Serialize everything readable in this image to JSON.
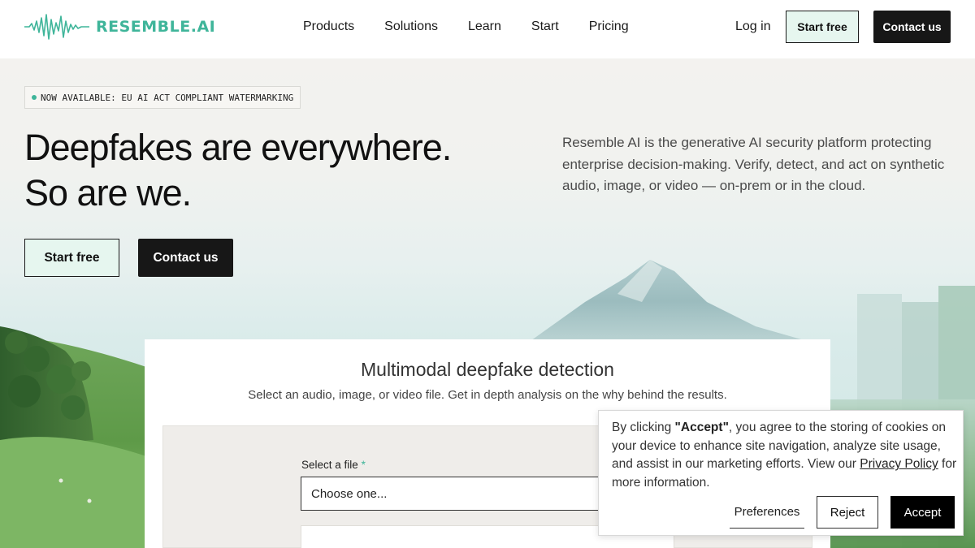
{
  "nav": {
    "logo_text": "RESEMBLE.AI",
    "links": [
      "Products",
      "Solutions",
      "Learn",
      "Start",
      "Pricing"
    ],
    "login": "Log in",
    "start_free": "Start free",
    "contact": "Contact us"
  },
  "hero": {
    "badge": "NOW AVAILABLE: EU AI ACT COMPLIANT WATERMARKING",
    "title_line1": "Deepfakes are everywhere.",
    "title_line2": "So are we.",
    "description": "Resemble AI is the generative AI security platform protecting enterprise decision-making. Verify, detect, and act on synthetic audio, image, or video — on-prem or in the cloud.",
    "start_free": "Start free",
    "contact": "Contact us"
  },
  "detection": {
    "title": "Multimodal deepfake detection",
    "subtitle": "Select an audio, image, or video file. Get in depth analysis on the why behind the results.",
    "file_label": "Select a file",
    "required_mark": "*",
    "file_placeholder": "Choose one..."
  },
  "cookie": {
    "text_before": "By clicking ",
    "accept_quoted": "\"Accept\"",
    "text_middle": ", you agree to the storing of cookies on your device to enhance site navigation, analyze site usage, and assist in our marketing efforts. View our ",
    "privacy_link": "Privacy Policy",
    "text_after": " for more information.",
    "preferences": "Preferences",
    "reject": "Reject",
    "accept": "Accept"
  },
  "colors": {
    "brand": "#3fb59a",
    "dark_button": "#171717",
    "light_button": "#e6f6ef"
  }
}
